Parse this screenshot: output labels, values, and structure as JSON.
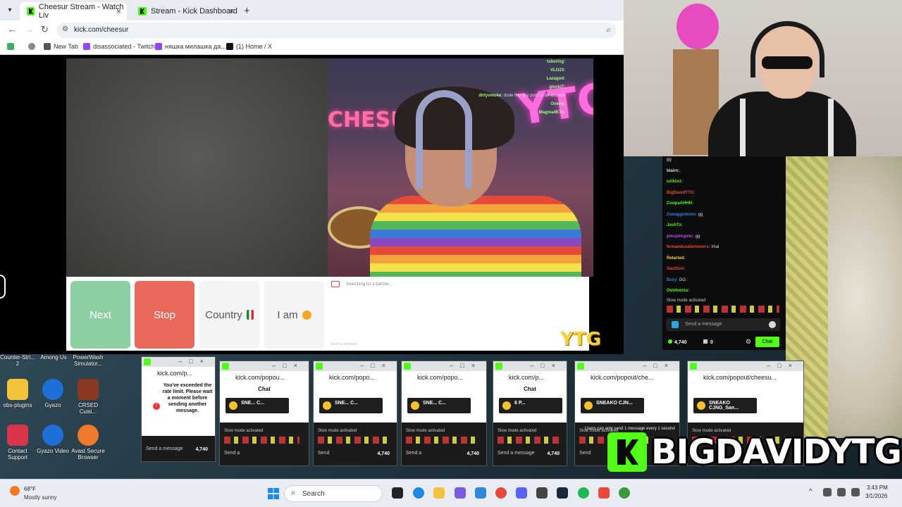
{
  "browser": {
    "tabs": [
      {
        "label": "Cheesur Stream - Watch Liv",
        "active": true
      },
      {
        "label": "Stream - Kick Dashboard",
        "active": false
      }
    ],
    "url": "kick.com/cheesur",
    "bookmarks": [
      "New Tab",
      "disassociated - Twitch",
      "няшка милашка да...",
      "(1) Home / X"
    ]
  },
  "stream": {
    "controls": {
      "next": "Next",
      "stop": "Stop",
      "country": "Country",
      "iam": "I am"
    },
    "chatbox_status": "Searching for a partner...",
    "chatbox_placeholder": "Send a message",
    "watermark": "YTG",
    "neon_left": "CHESUR",
    "neon_right": "YTG",
    "overlay_chat": [
      {
        "user": "tsboring:",
        "text": ""
      },
      {
        "user": "VLO23:",
        "text": ""
      },
      {
        "user": "Lazagod:",
        "text": ""
      },
      {
        "user": "glocki7:",
        "text": ""
      },
      {
        "user": "dirtysmoke:",
        "text": "dude this guy poor ur an asshole"
      },
      {
        "user": "Overly:",
        "text": ""
      },
      {
        "user": "Magma4KTo:",
        "text": ""
      }
    ]
  },
  "side_chat": {
    "lines": [
      {
        "user": "",
        "text": "gg",
        "color": "#53fc18"
      },
      {
        "user": "blairn:",
        "text": "",
        "color": "#dddddd"
      },
      {
        "user": "uzikzxz:",
        "text": "",
        "color": "#53fc18"
      },
      {
        "user": "BigDavidYTG:",
        "text": "",
        "color": "#e84a3a"
      },
      {
        "user": "CoopaAHHH:",
        "text": "",
        "color": "#53fc18"
      },
      {
        "user": "2swaggedown:",
        "text": "gg",
        "color": "#3a7ad8"
      },
      {
        "user": "JoshTx:",
        "text": "",
        "color": "#53fc18"
      },
      {
        "user": "pmcpmcpmc:",
        "text": "gg",
        "color": "#c050f0"
      },
      {
        "user": "fernandusaternovers:",
        "text": "lmal",
        "color": "#e84a3a"
      },
      {
        "user": "Retarted:",
        "text": "",
        "color": "#f5d23a"
      },
      {
        "user": "SaulGoo:",
        "text": "",
        "color": "#e84a3a"
      },
      {
        "user": "Bezy:",
        "text": "GG",
        "color": "#3a7ad8"
      },
      {
        "user": "Outdoorss:",
        "text": "",
        "color": "#53fc18"
      }
    ],
    "slow_mode": "Slow mode activated",
    "input_placeholder": "Send a message",
    "points": "4,740",
    "count": "0",
    "chat_button": "Chat"
  },
  "desktop_icons": [
    {
      "label": "Counter-Stri... 2"
    },
    {
      "label": "Among Us"
    },
    {
      "label": "PowerWash Simulator..."
    },
    {
      "label": "obs-plugins"
    },
    {
      "label": "Gyazo"
    },
    {
      "label": "CRSED Cuisi..."
    },
    {
      "label": "Contact Support"
    },
    {
      "label": "Gyazo Video"
    },
    {
      "label": "Avast Secure Browser"
    }
  ],
  "popouts": [
    {
      "url": "kick.com/p...",
      "head": "",
      "gift": "",
      "send": "Send a message",
      "points": "4,740"
    },
    {
      "url": "kick.com/popou...",
      "head": "Chat",
      "gift": "SNE... C...",
      "send": "Send a",
      "points": ""
    },
    {
      "url": "kick.com/popo...",
      "head": "",
      "gift": "SNE... C...",
      "send": "Send",
      "points": "4,740"
    },
    {
      "url": "kick.com/popo...",
      "head": "",
      "gift": "SNE... C...",
      "send": "Send a",
      "points": "4,740"
    },
    {
      "url": "kick.com/p...",
      "head": "Chat",
      "gift": "6 P...",
      "send": "Send a message",
      "points": "4,740"
    },
    {
      "url": "kick.com/popout/che...",
      "head": "",
      "gift": "SNEAKO CJN...",
      "send": "Send",
      "points": ""
    },
    {
      "url": "kick.com/popout/cheesu...",
      "head": "",
      "gift": "SNEAKO CJNG_San...",
      "send": "",
      "points": ""
    }
  ],
  "popout_slow_mode": "Slow mode activated",
  "rate_limit_msg": "You've exceeded the rate limit. Please wait a moment before sending another message.",
  "popout_small_notice": "Users can only send 1 message every 1 second",
  "banner": {
    "text": "BIGDAVIDYTG"
  },
  "taskbar": {
    "weather_temp": "68°F",
    "weather_desc": "Mostly sunny",
    "search": "Search",
    "time": "3:43 PM",
    "date": "3/1/2026"
  }
}
